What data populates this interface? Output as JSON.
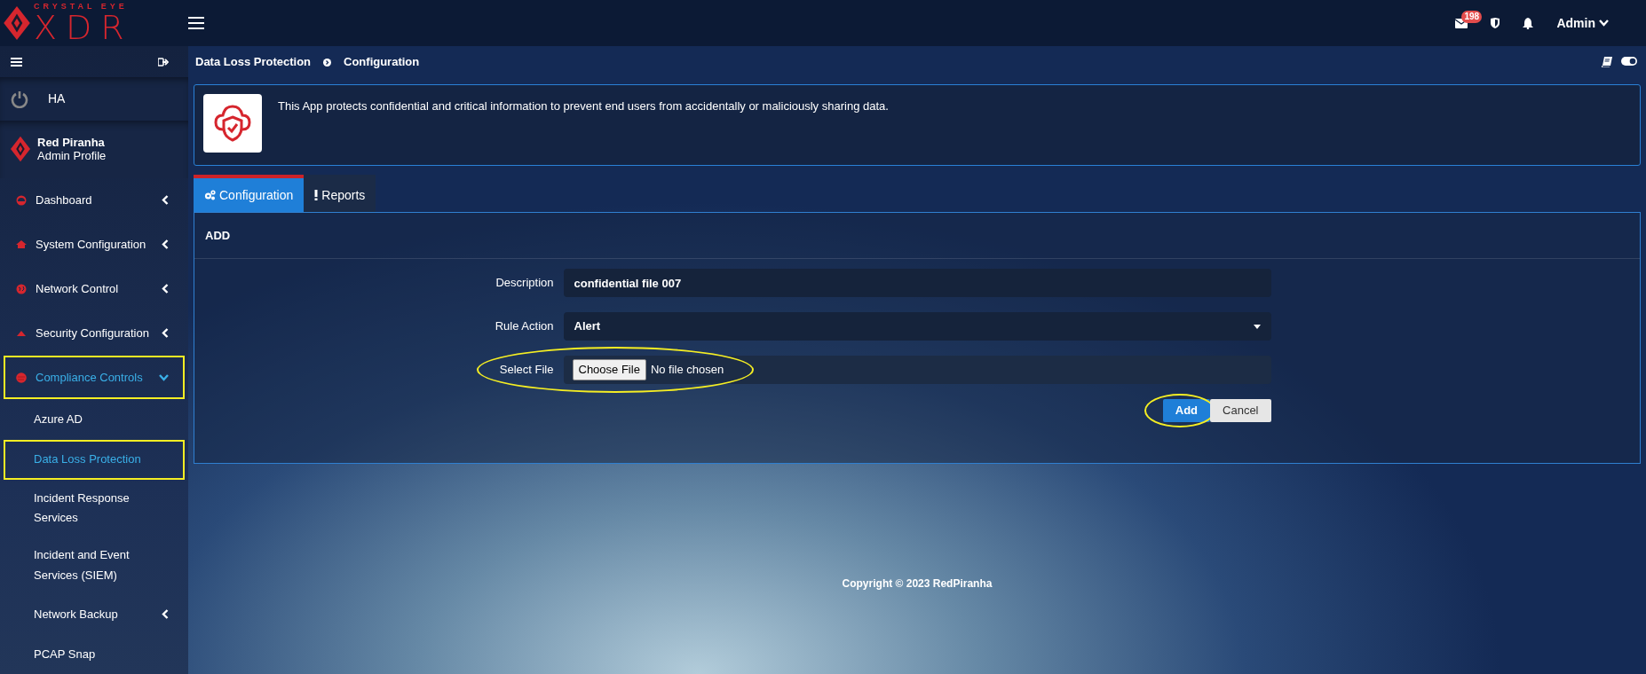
{
  "brand": {
    "tagline": "CRYSTAL EYE",
    "name": "XDR"
  },
  "header": {
    "mail_count": "198",
    "user": "Admin"
  },
  "sidebar": {
    "ha_label": "HA",
    "profile": {
      "name": "Red Piranha",
      "role": "Admin Profile"
    },
    "items": [
      {
        "label": "Dashboard",
        "expanded": false,
        "selected": false,
        "highlighted": false
      },
      {
        "label": "System Configuration",
        "expanded": false,
        "selected": false,
        "highlighted": false
      },
      {
        "label": "Network Control",
        "expanded": false,
        "selected": false,
        "highlighted": false
      },
      {
        "label": "Security Configuration",
        "expanded": false,
        "selected": false,
        "highlighted": false
      },
      {
        "label": "Compliance Controls",
        "expanded": true,
        "selected": true,
        "highlighted": true,
        "children": [
          {
            "label": "Azure AD",
            "selected": false,
            "highlighted": false
          },
          {
            "label": "Data Loss Protection",
            "selected": true,
            "highlighted": true
          },
          {
            "label": "Incident Response Services",
            "selected": false,
            "highlighted": false
          },
          {
            "label": "Incident and Event Services (SIEM)",
            "selected": false,
            "highlighted": false
          },
          {
            "label": "Network Backup",
            "expanded": false,
            "selected": false,
            "highlighted": false
          },
          {
            "label": "PCAP Snap",
            "selected": false,
            "highlighted": false
          }
        ]
      }
    ]
  },
  "breadcrumb": [
    "Data Loss Protection",
    "Configuration"
  ],
  "app_info": {
    "description": "This App protects confidential and critical information to prevent end users from accidentally or maliciously sharing data."
  },
  "tabs": [
    {
      "label": "Configuration",
      "selected": true
    },
    {
      "label": "Reports",
      "selected": false
    }
  ],
  "panel": {
    "title": "ADD",
    "fields": [
      {
        "kind": "text",
        "label": "Description",
        "value": "confidential file 007",
        "highlighted": false
      },
      {
        "kind": "select",
        "label": "Rule Action",
        "value": "Alert",
        "highlighted": false
      },
      {
        "kind": "file",
        "label": "Select File",
        "button": "Choose File",
        "status": "No file chosen",
        "highlighted": true
      }
    ],
    "buttons": [
      {
        "label": "Add",
        "kind": "primary",
        "highlighted": true
      },
      {
        "label": "Cancel",
        "kind": "secondary",
        "highlighted": false
      }
    ]
  },
  "footer": "Copyright © 2023 RedPiranha"
}
